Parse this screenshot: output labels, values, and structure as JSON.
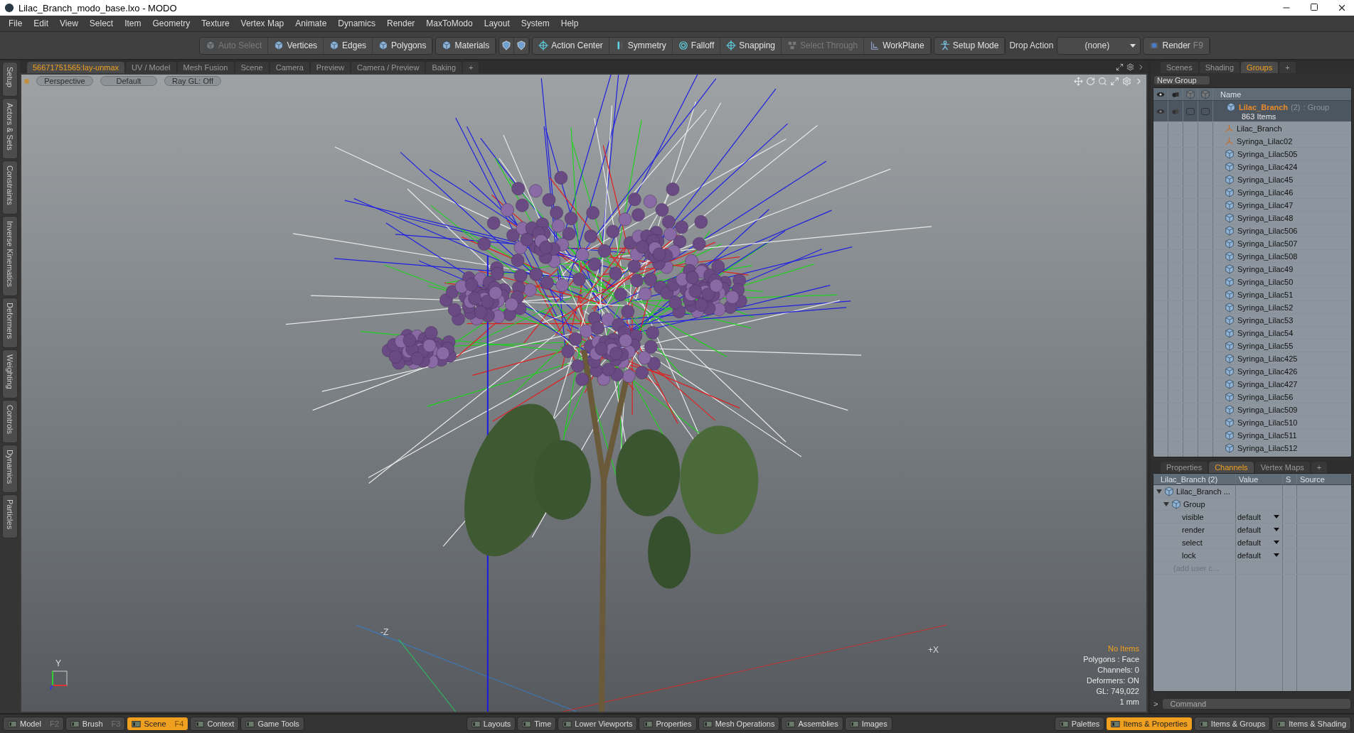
{
  "window": {
    "title": "Lilac_Branch_modo_base.lxo - MODO"
  },
  "menu": [
    "File",
    "Edit",
    "View",
    "Select",
    "Item",
    "Geometry",
    "Texture",
    "Vertex Map",
    "Animate",
    "Dynamics",
    "Render",
    "MaxToModo",
    "Layout",
    "System",
    "Help"
  ],
  "toolbar": {
    "groups": [
      [
        {
          "kind": "button",
          "label": "Auto Select",
          "disabled": true
        },
        {
          "kind": "button",
          "label": "Vertices",
          "disabled": false
        },
        {
          "kind": "button",
          "label": "Edges",
          "disabled": false
        },
        {
          "kind": "button",
          "label": "Polygons",
          "disabled": false
        }
      ],
      [
        {
          "kind": "button",
          "label": "Materials",
          "disabled": false
        }
      ],
      [
        {
          "kind": "icon",
          "disabled": false
        },
        {
          "kind": "icon",
          "disabled": false
        }
      ],
      [
        {
          "kind": "button",
          "label": "Action Center",
          "disabled": false
        },
        {
          "kind": "button",
          "label": "Symmetry",
          "disabled": false
        },
        {
          "kind": "button",
          "label": "Falloff",
          "disabled": false
        },
        {
          "kind": "button",
          "label": "Snapping",
          "disabled": false
        },
        {
          "kind": "button",
          "label": "Select Through",
          "disabled": true
        },
        {
          "kind": "button",
          "label": "WorkPlane",
          "disabled": false
        }
      ],
      [
        {
          "kind": "button",
          "label": "Setup Mode",
          "disabled": false
        }
      ],
      [
        {
          "kind": "label",
          "label": "Drop Action"
        }
      ],
      [
        {
          "kind": "dropdown",
          "value": "(none)"
        }
      ],
      [
        {
          "kind": "button",
          "label": "Render",
          "shortcut": "F9",
          "disabled": false
        }
      ]
    ]
  },
  "side_tabs": [
    "Setup",
    "Actors & Sets",
    "Constraints",
    "Inverse Kinematics",
    "Deformers",
    "Weighting",
    "Controls",
    "Dynamics",
    "Particles"
  ],
  "viewport_tabs": [
    {
      "label": "56671751565:lay-unmax",
      "selected": true
    },
    {
      "label": "UV / Model",
      "selected": false
    },
    {
      "label": "Mesh Fusion",
      "selected": false
    },
    {
      "label": "Scene",
      "selected": false
    },
    {
      "label": "Camera",
      "selected": false
    },
    {
      "label": "Preview",
      "selected": false
    },
    {
      "label": "Camera / Preview",
      "selected": false
    },
    {
      "label": "Baking",
      "selected": false
    },
    {
      "label": "+",
      "selected": false
    }
  ],
  "viewport": {
    "buttons": [
      "Perspective",
      "Default",
      "Ray GL: Off"
    ],
    "axis_labels": [
      "-Z",
      "+X"
    ],
    "gizmo_label": "Y",
    "info": [
      {
        "text": "No Items",
        "highlight": true
      },
      {
        "text": "Polygons : Face",
        "highlight": false
      },
      {
        "text": "Channels: 0",
        "highlight": false
      },
      {
        "text": "Deformers: ON",
        "highlight": false
      },
      {
        "text": "GL: 749,022",
        "highlight": false
      },
      {
        "text": "1 mm",
        "highlight": false
      }
    ]
  },
  "groups_panel": {
    "tabs": [
      {
        "label": "Scenes",
        "selected": false
      },
      {
        "label": "Shading",
        "selected": false
      },
      {
        "label": "Groups",
        "selected": true
      },
      {
        "label": "+",
        "selected": false
      }
    ],
    "new_group": "New Group",
    "name_column": "Name",
    "group": {
      "name": "Lilac_Branch",
      "count": "(2)",
      "type": ": Group",
      "items": "863 Items",
      "children": [
        {
          "name": "Lilac_Branch",
          "kind": "locator"
        },
        {
          "name": "Syringa_Lilac02",
          "kind": "locator"
        },
        {
          "name": "Syringa_Lilac505",
          "kind": "mesh"
        },
        {
          "name": "Syringa_Lilac424",
          "kind": "mesh"
        },
        {
          "name": "Syringa_Lilac45",
          "kind": "mesh"
        },
        {
          "name": "Syringa_Lilac46",
          "kind": "mesh"
        },
        {
          "name": "Syringa_Lilac47",
          "kind": "mesh"
        },
        {
          "name": "Syringa_Lilac48",
          "kind": "mesh"
        },
        {
          "name": "Syringa_Lilac506",
          "kind": "mesh"
        },
        {
          "name": "Syringa_Lilac507",
          "kind": "mesh"
        },
        {
          "name": "Syringa_Lilac508",
          "kind": "mesh"
        },
        {
          "name": "Syringa_Lilac49",
          "kind": "mesh"
        },
        {
          "name": "Syringa_Lilac50",
          "kind": "mesh"
        },
        {
          "name": "Syringa_Lilac51",
          "kind": "mesh"
        },
        {
          "name": "Syringa_Lilac52",
          "kind": "mesh"
        },
        {
          "name": "Syringa_Lilac53",
          "kind": "mesh"
        },
        {
          "name": "Syringa_Lilac54",
          "kind": "mesh"
        },
        {
          "name": "Syringa_Lilac55",
          "kind": "mesh"
        },
        {
          "name": "Syringa_Lilac425",
          "kind": "mesh"
        },
        {
          "name": "Syringa_Lilac426",
          "kind": "mesh"
        },
        {
          "name": "Syringa_Lilac427",
          "kind": "mesh"
        },
        {
          "name": "Syringa_Lilac56",
          "kind": "mesh"
        },
        {
          "name": "Syringa_Lilac509",
          "kind": "mesh"
        },
        {
          "name": "Syringa_Lilac510",
          "kind": "mesh"
        },
        {
          "name": "Syringa_Lilac511",
          "kind": "mesh"
        },
        {
          "name": "Syringa_Lilac512",
          "kind": "mesh"
        }
      ]
    }
  },
  "channels_panel": {
    "tabs": [
      {
        "label": "Properties",
        "selected": false
      },
      {
        "label": "Channels",
        "selected": true
      },
      {
        "label": "Vertex Maps",
        "selected": false
      },
      {
        "label": "+",
        "selected": false
      }
    ],
    "columns": [
      "Lilac_Branch (2)",
      "Value",
      "S",
      "Source"
    ],
    "root": {
      "label": "Lilac_Branch ...",
      "expanded": true,
      "group": {
        "label": "Group",
        "expanded": true,
        "channels": [
          {
            "name": "visible",
            "value": "default"
          },
          {
            "name": "render",
            "value": "default"
          },
          {
            "name": "select",
            "value": "default"
          },
          {
            "name": "lock",
            "value": "default"
          }
        ],
        "add_user": "(add user c..."
      }
    }
  },
  "command": {
    "prompt": ">",
    "placeholder": "Command"
  },
  "bottom_bar": {
    "sections": [
      [
        {
          "label": "Model",
          "shortcut": "F2",
          "selected": false
        },
        {
          "label": "Brush",
          "shortcut": "F3",
          "selected": false
        },
        {
          "label": "Scene",
          "shortcut": "F4",
          "selected": true
        },
        {
          "label": "Context",
          "selected": false
        },
        {
          "label": "Game Tools",
          "selected": false
        }
      ],
      [
        {
          "label": "Layouts",
          "selected": false
        },
        {
          "label": "Time",
          "selected": false
        },
        {
          "label": "Lower Viewports",
          "selected": false
        },
        {
          "label": "Properties",
          "selected": false
        },
        {
          "label": "Mesh Operations",
          "selected": false
        },
        {
          "label": "Assemblies",
          "selected": false
        },
        {
          "label": "Images",
          "selected": false
        }
      ],
      [
        {
          "label": "Palettes",
          "selected": false
        },
        {
          "label": "Items & Properties",
          "selected": true
        },
        {
          "label": "Items & Groups",
          "selected": false
        },
        {
          "label": "Items & Shading",
          "selected": false
        }
      ]
    ]
  }
}
